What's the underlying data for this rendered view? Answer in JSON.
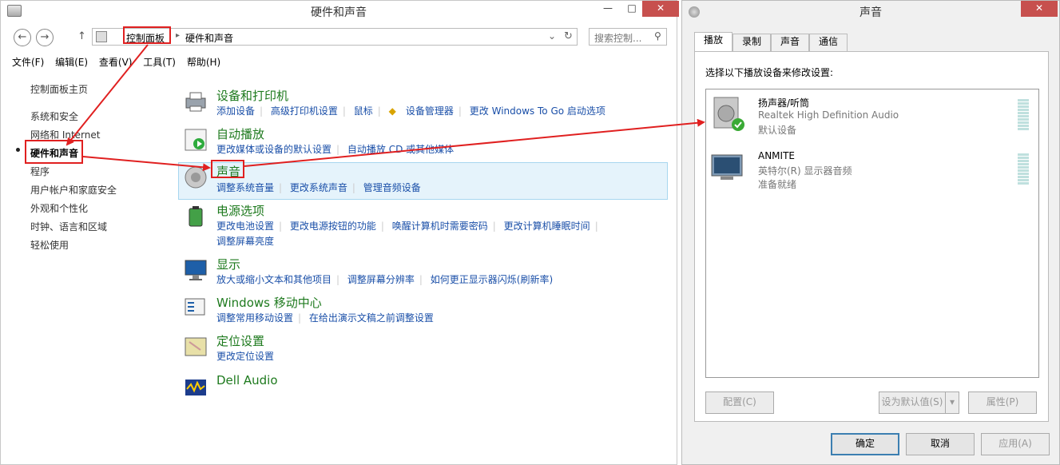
{
  "left_window": {
    "title": "硬件和声音",
    "controls": {
      "minimize": "—",
      "maximize": "□",
      "close": "✕"
    },
    "nav": {
      "back": "←",
      "forward": "→",
      "up": "↑",
      "refresh": "↻",
      "dropdown": "⌄"
    },
    "breadcrumbs": [
      "控制面板",
      "硬件和声音"
    ],
    "search_placeholder": "搜索控制...",
    "menu": [
      "文件(F)",
      "编辑(E)",
      "查看(V)",
      "工具(T)",
      "帮助(H)"
    ],
    "sidebar": [
      "控制面板主页",
      "系统和安全",
      "网络和 Internet",
      "硬件和声音",
      "程序",
      "用户帐户和家庭安全",
      "外观和个性化",
      "时钟、语言和区域",
      "轻松使用"
    ],
    "categories": [
      {
        "title": "设备和打印机",
        "links": [
          "添加设备",
          "高级打印机设置",
          "鼠标",
          "设备管理器",
          "更改 Windows To Go 启动选项"
        ]
      },
      {
        "title": "自动播放",
        "links": [
          "更改媒体或设备的默认设置",
          "自动播放 CD 或其他媒体"
        ]
      },
      {
        "title": "声音",
        "links": [
          "调整系统音量",
          "更改系统声音",
          "管理音频设备"
        ]
      },
      {
        "title": "电源选项",
        "links": [
          "更改电池设置",
          "更改电源按钮的功能",
          "唤醒计算机时需要密码",
          "更改计算机睡眠时间"
        ],
        "links2": [
          "调整屏幕亮度"
        ]
      },
      {
        "title": "显示",
        "links": [
          "放大或缩小文本和其他项目",
          "调整屏幕分辨率",
          "如何更正显示器闪烁(刷新率)"
        ]
      },
      {
        "title": "Windows 移动中心",
        "links": [
          "调整常用移动设置",
          "在给出演示文稿之前调整设置"
        ]
      },
      {
        "title": "定位设置",
        "links": [
          "更改定位设置"
        ]
      },
      {
        "title": "Dell Audio",
        "links": []
      }
    ]
  },
  "sound_dialog": {
    "title": "声音",
    "close": "✕",
    "tabs": [
      "播放",
      "录制",
      "声音",
      "通信"
    ],
    "instruction": "选择以下播放设备来修改设置:",
    "devices": [
      {
        "name": "扬声器/听筒",
        "desc": "Realtek High Definition Audio",
        "status": "默认设备"
      },
      {
        "name": "ANMITE",
        "desc": "英特尔(R) 显示器音频",
        "status": "准备就绪"
      }
    ],
    "buttons": {
      "configure": "配置(C)",
      "set_default": "设为默认值(S)",
      "properties": "属性(P)",
      "ok": "确定",
      "cancel": "取消",
      "apply": "应用(A)"
    }
  },
  "colors": {
    "link": "#1a4fa8",
    "category": "#1e7a1e",
    "annotation": "#e02020",
    "highlight": "#e5f3fb"
  }
}
